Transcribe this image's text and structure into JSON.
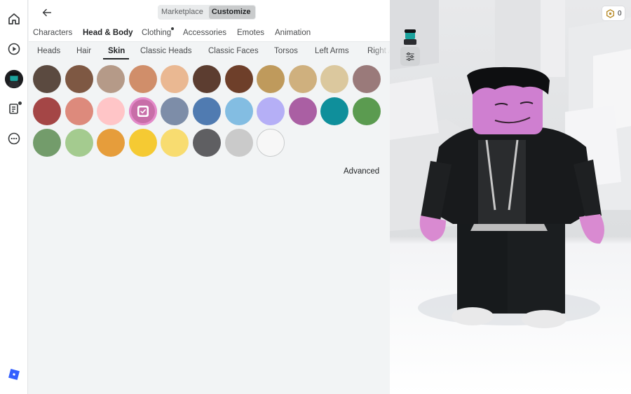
{
  "nav": {
    "rail_items": [
      "home-icon",
      "play-icon",
      "avatar-icon",
      "notes-icon",
      "more-icon",
      "roblox-logo-icon"
    ]
  },
  "header": {
    "segments": [
      {
        "label": "Marketplace",
        "active": false
      },
      {
        "label": "Customize",
        "active": true
      }
    ]
  },
  "categories": [
    "Characters",
    "Head & Body",
    "Clothing",
    "Accessories",
    "Emotes",
    "Animation"
  ],
  "active_category": "Head & Body",
  "subcategories": [
    "Heads",
    "Hair",
    "Skin",
    "Classic Heads",
    "Classic Faces",
    "Torsos",
    "Left Arms",
    "Right Arms"
  ],
  "active_subcategory": "Skin",
  "skin_colors": [
    "#5b4a40",
    "#7e5843",
    "#b59a88",
    "#d08e6a",
    "#eab892",
    "#5c3d30",
    "#6e3f2a",
    "#bf9a5c",
    "#cfb07e",
    "#dbc89e",
    "#9a7a7a",
    "#a44646",
    "#dd8a7c",
    "#ffc5c7",
    "#c86ea8",
    "#7d8da8",
    "#507bb1",
    "#83bde2",
    "#b5aff6",
    "#aa5fa3",
    "#0f8f9b",
    "#5b9b50",
    "#739c6b",
    "#a4cb8f",
    "#e69d3b",
    "#f5ca33",
    "#f8dc70",
    "#5f5f62",
    "#cacaca",
    "#f7f7f7"
  ],
  "selected_color": "#c86ea8",
  "advanced_label": "Advanced",
  "currency": {
    "amount": "0"
  },
  "colors": {
    "accent_pink": "#e48ac9",
    "panel_bg": "#f2f4f5"
  }
}
